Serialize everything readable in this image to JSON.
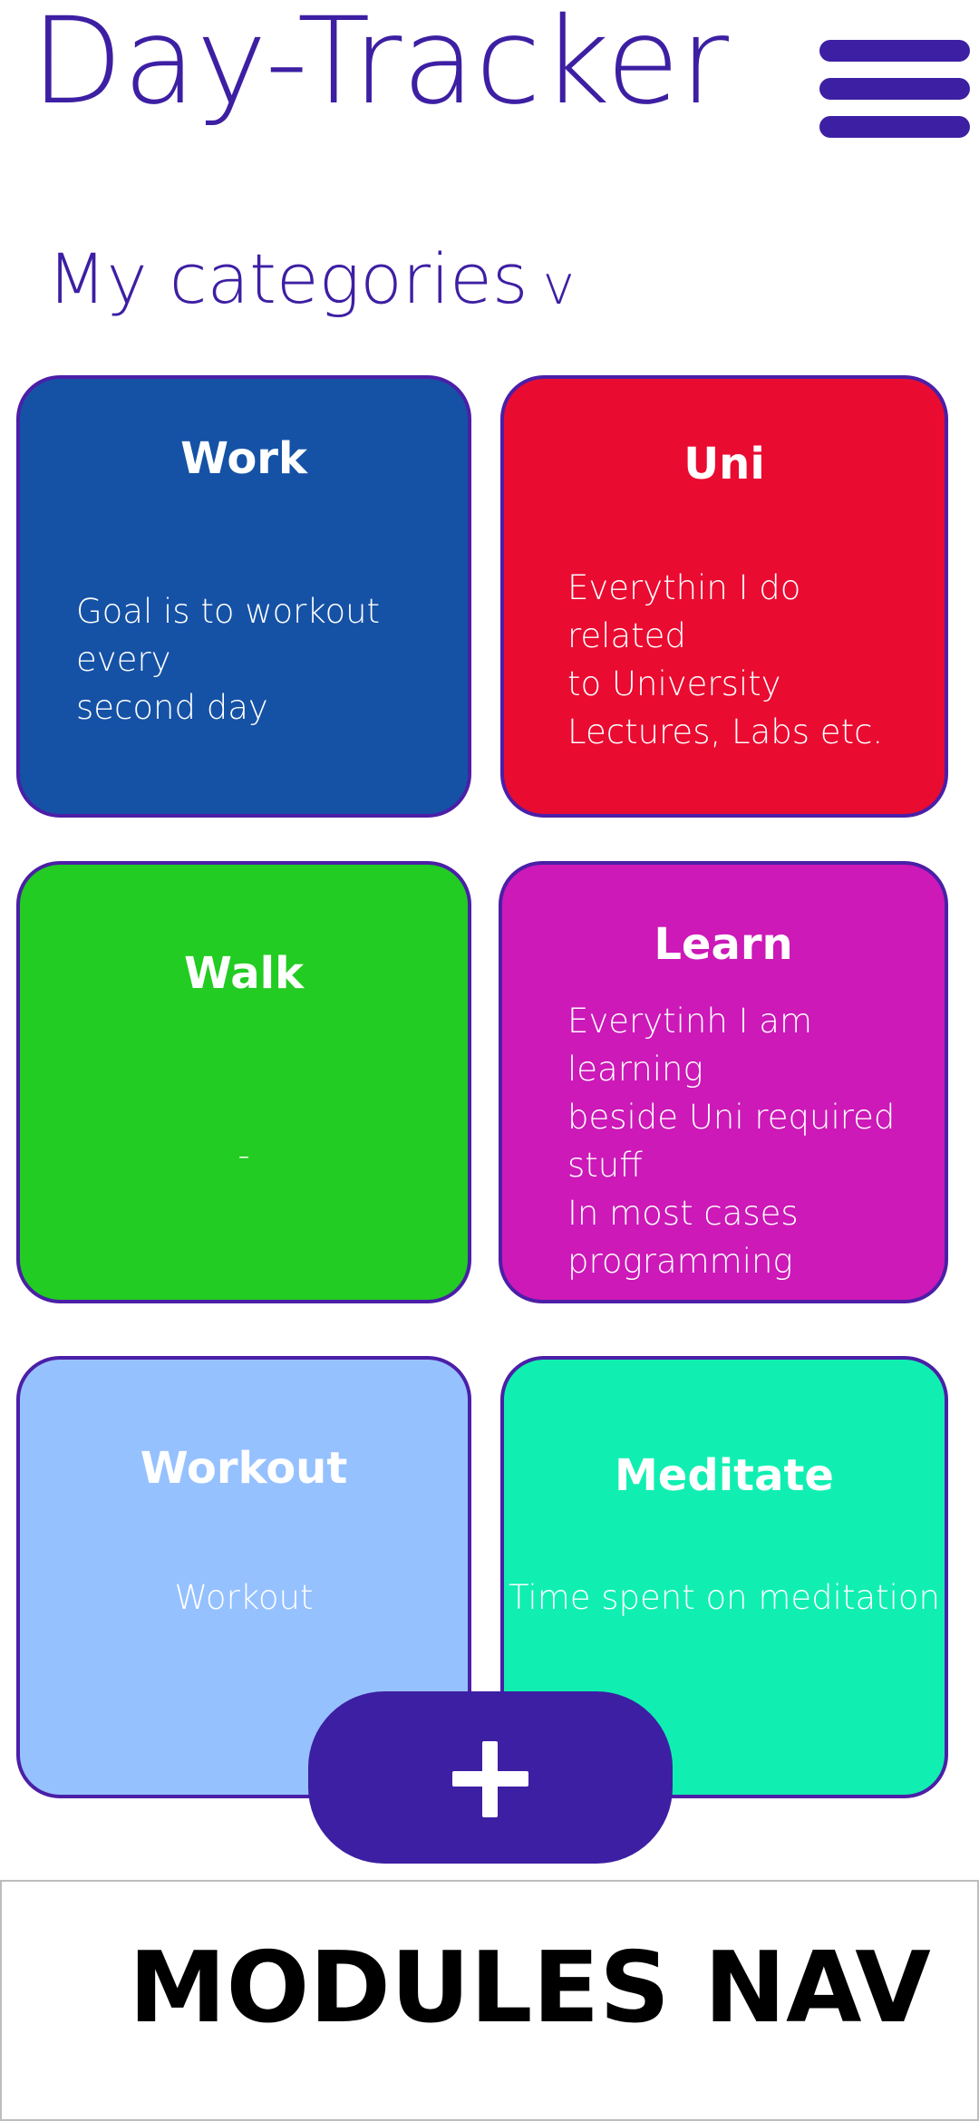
{
  "app": {
    "title": "Day-Tracker"
  },
  "header": {
    "menu_icon": "hamburger-menu-icon"
  },
  "categories": {
    "section_title": "My categories",
    "toggle_glyph": "v",
    "items": [
      {
        "name": "Work",
        "description": "Goal is to workout every\nsecond day",
        "color": "#1552a6"
      },
      {
        "name": "Uni",
        "description": "Everythin I do related\nto University\nLectures, Labs etc.",
        "color": "#ea0b31"
      },
      {
        "name": "Walk",
        "description": "-",
        "color": "#22cc22"
      },
      {
        "name": "Learn",
        "description": "Everytinh I am learning\nbeside Uni required\nstuff\nIn most cases\nprogramming",
        "color": "#cc19b8"
      },
      {
        "name": "Workout",
        "description": "Workout",
        "color": "#96c1ff"
      },
      {
        "name": "Meditate",
        "description": "Time spent on meditation",
        "color": "#10efb1"
      }
    ]
  },
  "actions": {
    "add_icon": "plus-icon"
  },
  "bottom_nav": {
    "label": "MODULES NAV"
  },
  "colors": {
    "accent": "#3d1fa3",
    "card_border": "#4b1fa7",
    "background": "#ffffff",
    "text_on_card": "#ffffff"
  }
}
